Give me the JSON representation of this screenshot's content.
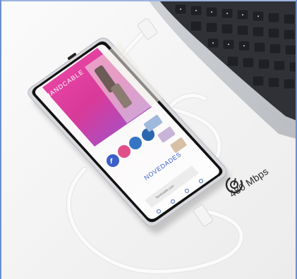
{
  "phone_screen": {
    "brand": "HANDCABLE",
    "heading": "NOVEDADES",
    "url": "handcable.com"
  },
  "speed_badge": {
    "label": "480 Mbps",
    "icon": "speedometer-icon"
  },
  "colors": {
    "magenta": "#e0399b",
    "phone_frame": "#d7d9dc",
    "cable": "#f7f7f7",
    "laptop_dark": "#3a3c40",
    "text_blue": "#3a5fc8"
  }
}
